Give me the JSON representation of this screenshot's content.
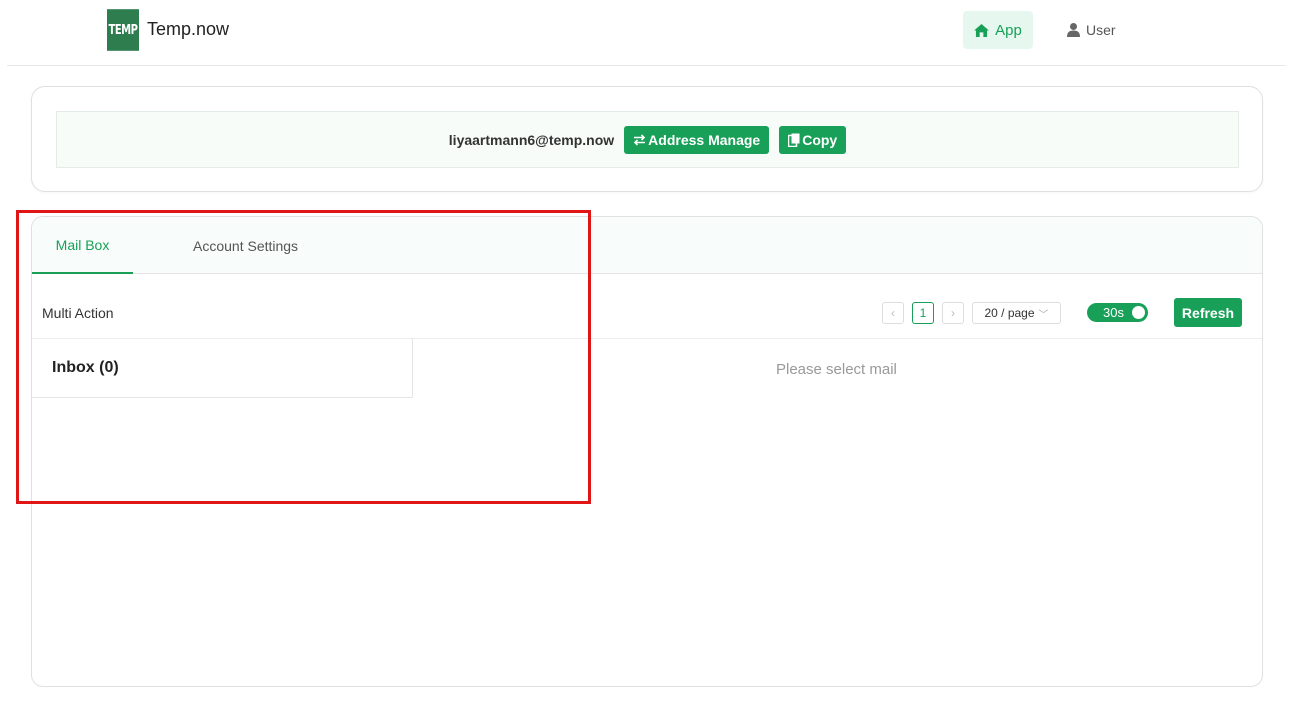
{
  "header": {
    "logo_text": "TEMP",
    "site_title": "Temp.now",
    "nav": [
      {
        "label": "App",
        "icon": "home-icon"
      },
      {
        "label": "User",
        "icon": "user-icon"
      }
    ]
  },
  "address": {
    "email": "liyaartmann6@temp.now",
    "manage_label": "Address Manage",
    "copy_label": "Copy"
  },
  "tabs": [
    {
      "label": "Mail Box"
    },
    {
      "label": "Account Settings"
    }
  ],
  "toolbar": {
    "multi_action": "Multi Action",
    "current_page": "1",
    "page_size": "20 / page",
    "auto_refresh": "30s",
    "refresh_label": "Refresh"
  },
  "mailbox": {
    "inbox_label": "Inbox (0)",
    "empty_text": "Please select mail"
  },
  "colors": {
    "accent": "#18a058",
    "highlight": "#e01515"
  }
}
